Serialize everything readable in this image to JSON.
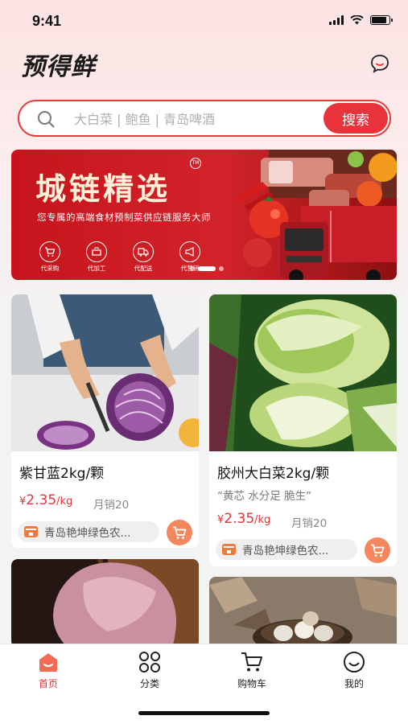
{
  "status_bar": {
    "time": "9:41",
    "battery_level": 0.85
  },
  "header": {
    "app_name": "预得鲜",
    "message_icon": "chat-bubble-icon"
  },
  "search": {
    "placeholder": "大白菜 | 鲍鱼 | 青岛啤酒",
    "button_label": "搜索"
  },
  "banner": {
    "title": "城链精选",
    "trademark": "TM",
    "subtitle": "您专属的高端食材预制菜供应链服务大师",
    "services": [
      {
        "label": "代采购",
        "icon": "cart-icon"
      },
      {
        "label": "代加工",
        "icon": "pot-icon"
      },
      {
        "label": "代配送",
        "icon": "truck-icon"
      },
      {
        "label": "代营销",
        "icon": "megaphone-icon"
      }
    ],
    "slide_count": 3,
    "active_slide": 2
  },
  "products": [
    {
      "title": "紫甘蓝2kg/颗",
      "tagline": "",
      "currency": "¥",
      "price": "2.35",
      "unit": "/kg",
      "sales": "月销20",
      "shop": "青岛艳坤绿色农...",
      "image": "purple-cabbage-photo"
    },
    {
      "title": "胶州大白菜2kg/颗",
      "tagline": "“黄芯 水分足 脆生”",
      "currency": "¥",
      "price": "2.35",
      "unit": "/kg",
      "sales": "月销20",
      "shop": "青岛艳坤绿色农...",
      "image": "napa-cabbage-photo"
    },
    {
      "title": "",
      "image": "raw-meat-photo"
    },
    {
      "title": "",
      "image": "eggs-basket-photo"
    }
  ],
  "bottom_nav": [
    {
      "label": "首页",
      "icon": "home-icon",
      "active": true
    },
    {
      "label": "分类",
      "icon": "category-grid-icon",
      "active": false
    },
    {
      "label": "购物车",
      "icon": "shopping-cart-icon",
      "active": false
    },
    {
      "label": "我的",
      "icon": "smiley-profile-icon",
      "active": false
    }
  ],
  "colors": {
    "accent": "#e8333a",
    "banner_red": "#c7141c",
    "cart_orange": "#f5875e"
  }
}
